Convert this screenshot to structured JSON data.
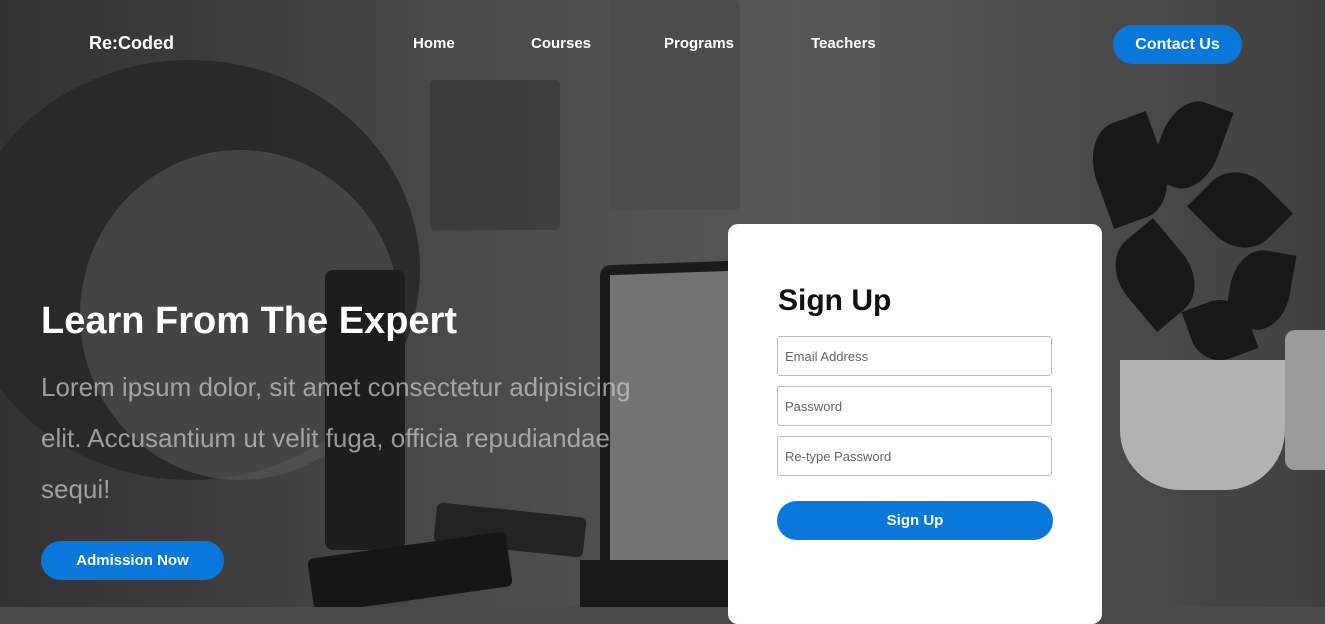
{
  "nav": {
    "logo": "Re:Coded",
    "links": [
      "Home",
      "Courses",
      "Programs",
      "Teachers"
    ],
    "contact_label": "Contact Us"
  },
  "hero": {
    "title": "Learn From The Expert",
    "description": "Lorem ipsum dolor, sit amet consectetur adipisicing elit. Accusantium ut velit fuga, officia repudiandae sequi!",
    "admission_label": "Admission Now"
  },
  "signup": {
    "title": "Sign Up",
    "email_placeholder": "Email Address",
    "password_placeholder": "Password",
    "retype_placeholder": "Re-type Password",
    "submit_label": "Sign Up"
  },
  "colors": {
    "accent": "#0a78db"
  }
}
